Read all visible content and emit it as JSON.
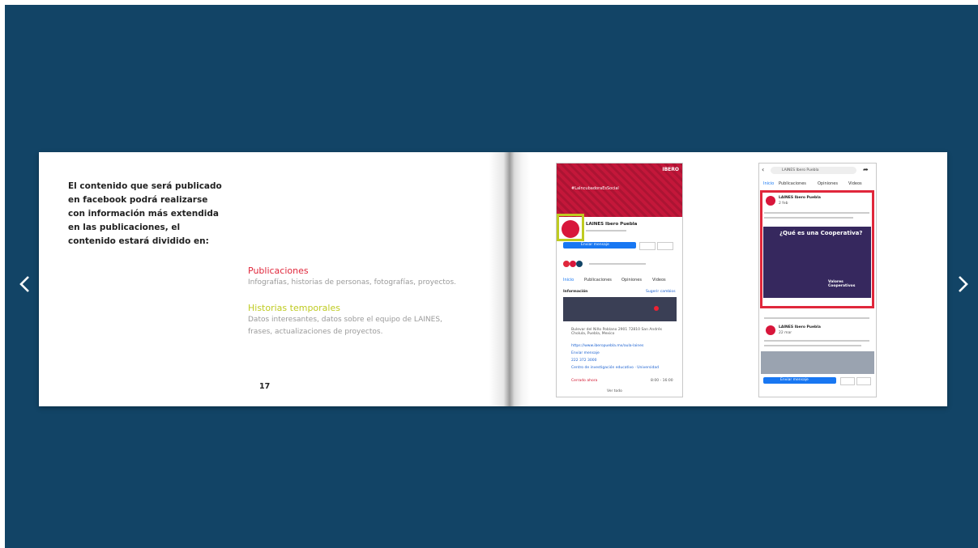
{
  "nav": {
    "prev_icon": "chevron-left-icon",
    "next_icon": "chevron-right-icon"
  },
  "left_page": {
    "intro": "El contenido que será publicado en facebook podrá realizarse con información más extendida en las publicaciones, el contenido estará dividido en:",
    "sections": [
      {
        "title": "Publicaciones",
        "title_color": "#e0273b",
        "description": "Infografías, historias de personas, fotografías, proyectos."
      },
      {
        "title": "Historias temporales",
        "title_color": "#bfcb21",
        "description": "Datos interesantes, datos sobre el equipo de LAINES, frases, actualizaciones de proyectos."
      }
    ],
    "page_number": "17"
  },
  "right_page": {
    "phone1": {
      "cover_text": "#LaIncubadoraEsSocial",
      "cover_logo": "IBERO",
      "page_name": "LAINES Ibero Puebla",
      "send_message": "Enviar mensaje",
      "tabs": [
        "Inicio",
        "Publicaciones",
        "Opiniones",
        "Videos"
      ],
      "info_label": "Información",
      "suggest_edit": "Sugerir cambios",
      "address": "Bulevar del Niño Poblano 2901 72810 San Andrés Cholula, Puebla, Mexico",
      "website": "https://www.iberopuebla.mx/aula-laines",
      "send_msg2": "Enviar mensaje",
      "phone": "222 372 3000",
      "category": "Centro de investigación educativo · Universidad",
      "status": "Cerrado ahora",
      "hours": "8:00 - 16:00",
      "see_all": "Ver todo"
    },
    "phone2": {
      "search": "LAINES Ibero Puebla",
      "tabs": [
        "Inicio",
        "Publicaciones",
        "Opiniones",
        "Videos"
      ],
      "post1_author": "LAINES Ibero Puebla",
      "post1_time": "2 feb",
      "coop_title": "¿Qué es una Cooperativa?",
      "coop_values": "Valores Cooperativos",
      "post2_author": "LAINES Ibero Puebla",
      "post2_time": "22 mar",
      "send_message": "Enviar mensaje"
    },
    "colors": {
      "highlight_yellow": "#bfcb21",
      "highlight_red": "#e0273b",
      "brand_red": "#c4173a"
    }
  }
}
